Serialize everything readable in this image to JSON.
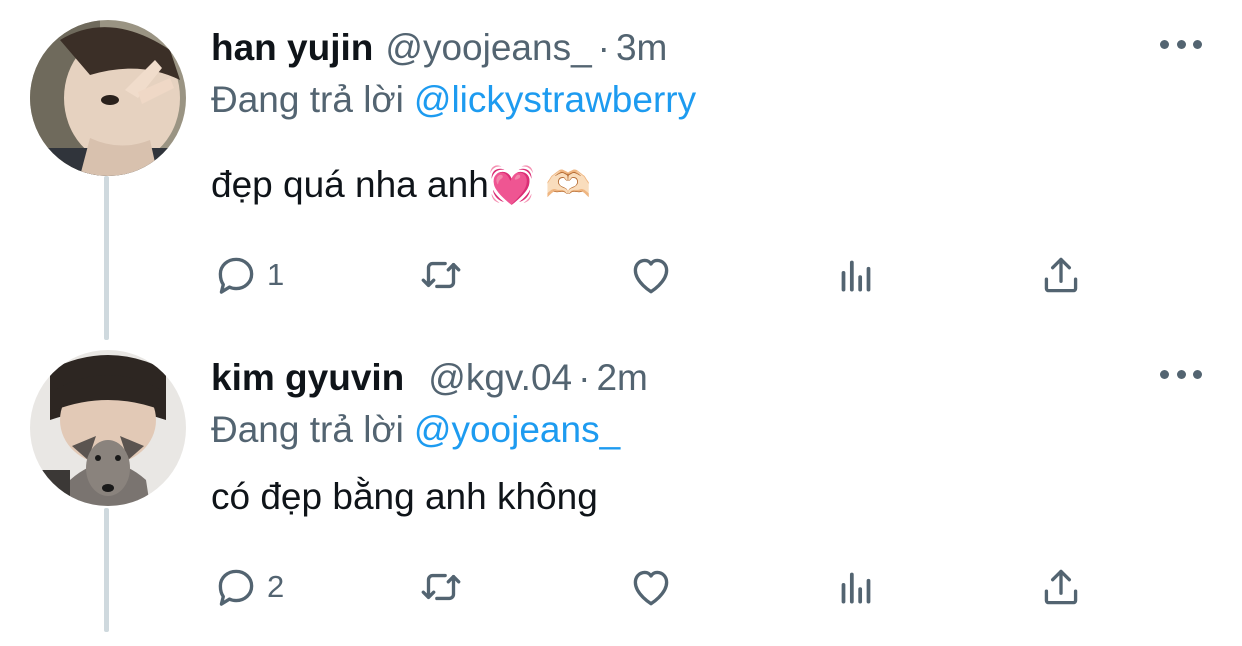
{
  "reply_prefix": "Đang trả lời",
  "tweets": [
    {
      "display_name": "han yujin",
      "handle": "@yoojeans_",
      "separator": "·",
      "time": "3m",
      "reply_to": "@lickystrawberry",
      "text": "đẹp quá nha anh💓 🫶🏻",
      "reply_count": "1",
      "avatar": "profile-photo-person-v-sign"
    },
    {
      "display_name": "kim gyuvin",
      "handle": "@kgv.04",
      "separator": "·",
      "time": "2m",
      "reply_to": "@yoojeans_",
      "text": "có đẹp bằng anh không",
      "reply_count": "2",
      "avatar": "profile-photo-person-with-dog"
    }
  ],
  "icons": [
    "reply-icon",
    "retweet-icon",
    "like-icon",
    "views-icon",
    "share-icon",
    "more-icon"
  ],
  "colors": {
    "text": "#0f1419",
    "muted": "#536471",
    "link": "#1d9bf0",
    "thread_line": "#cfd9de"
  }
}
